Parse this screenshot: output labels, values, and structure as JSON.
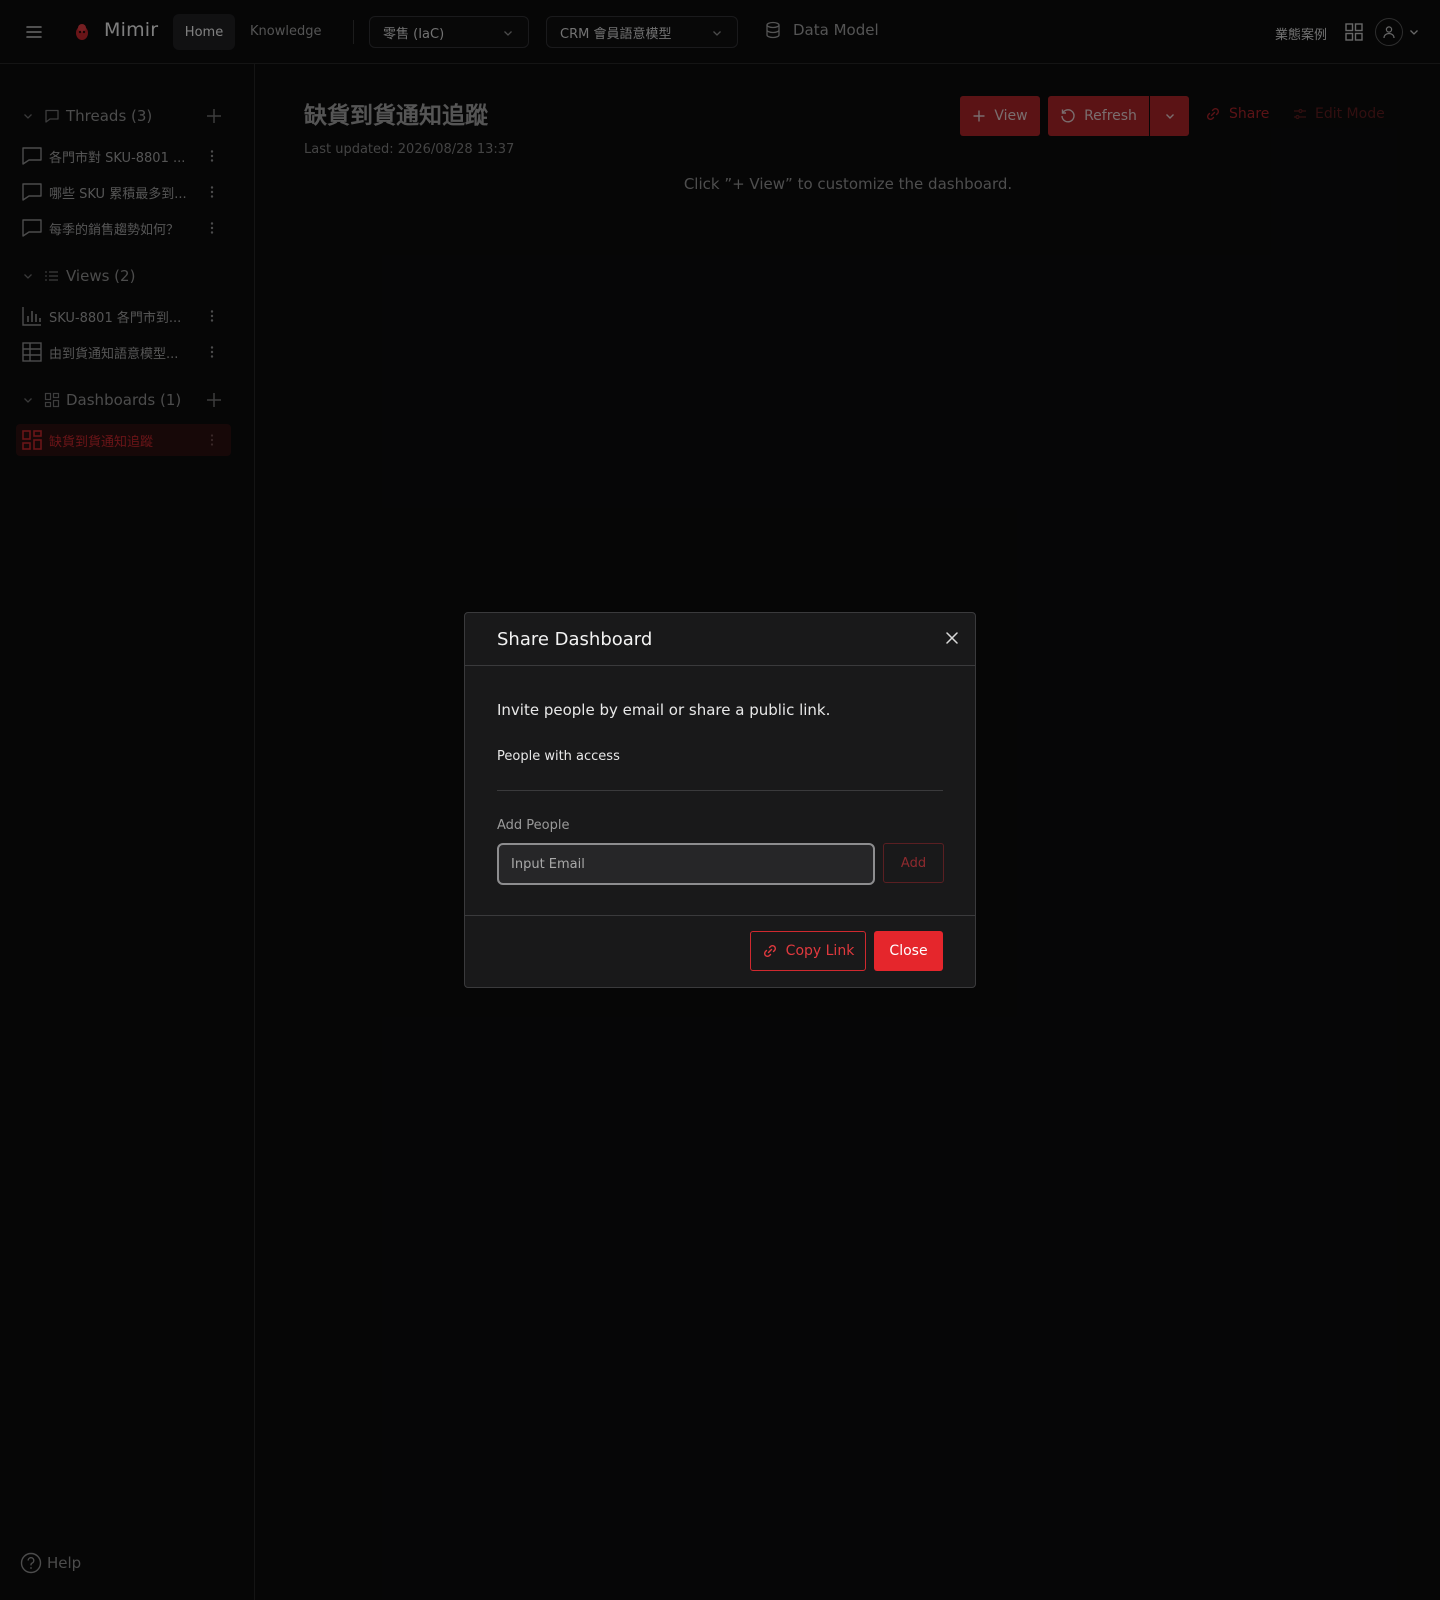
{
  "header": {
    "brand": "Mimir",
    "nav": {
      "home": "Home",
      "knowledge": "Knowledge"
    },
    "project_select": "零售 (IaC)",
    "model_select": "CRM 會員語意模型",
    "data_model": "Data Model",
    "business_cases": "業態案例",
    "brand_color": "#c0252b"
  },
  "sidebar": {
    "threads": {
      "title": "Threads (3)",
      "items": [
        "各門市對 SKU-8801 ...",
        "哪些 SKU 累積最多到...",
        "每季的銷售趨勢如何？"
      ]
    },
    "views": {
      "title": "Views (2)",
      "items": [
        "SKU-8801 各門市到...",
        "由到貨通知語意模型..."
      ]
    },
    "dashboards": {
      "title": "Dashboards (1)",
      "items": [
        "缺貨到貨通知追蹤"
      ]
    },
    "help": "Help"
  },
  "main": {
    "title": "缺貨到貨通知追蹤",
    "last_updated": "Last updated: 2026/08/28 13:37",
    "hint": "Click ”+ View” to customize the dashboard.",
    "buttons": {
      "view": "View",
      "refresh": "Refresh",
      "share": "Share",
      "edit_mode": "Edit Mode"
    }
  },
  "modal": {
    "title": "Share Dashboard",
    "description": "Invite people by email or share a public link.",
    "people_with_access": "People with access",
    "add_people": "Add People",
    "email_placeholder": "Input Email",
    "add": "Add",
    "copy_link": "Copy Link",
    "close": "Close"
  }
}
